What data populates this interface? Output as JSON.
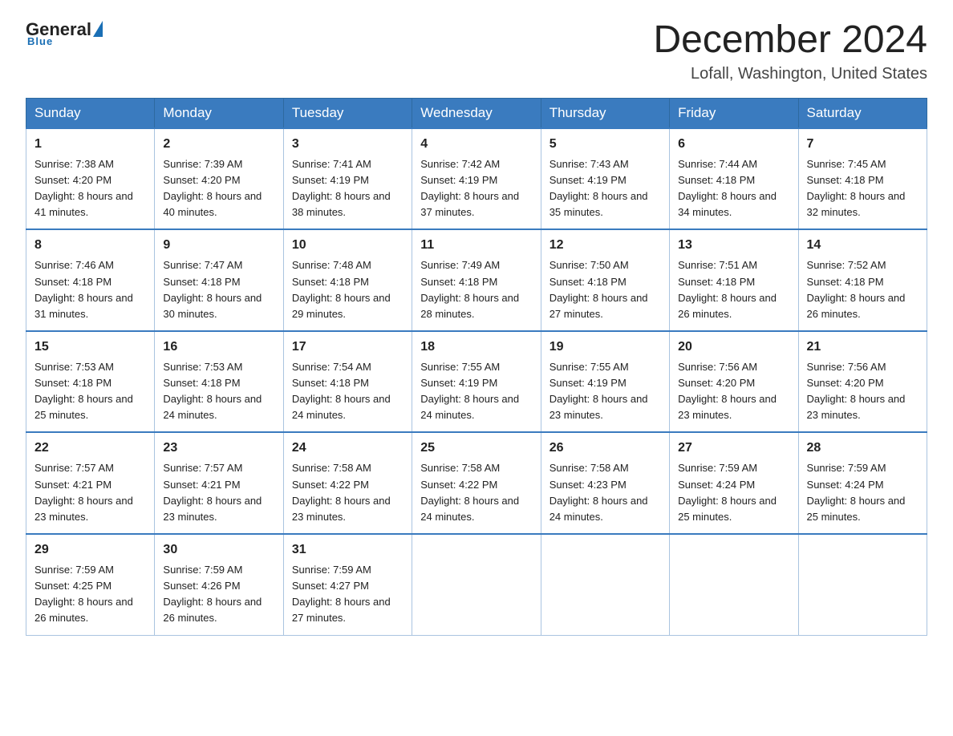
{
  "header": {
    "logo_general": "General",
    "logo_blue": "Blue",
    "main_title": "December 2024",
    "subtitle": "Lofall, Washington, United States"
  },
  "days_of_week": [
    "Sunday",
    "Monday",
    "Tuesday",
    "Wednesday",
    "Thursday",
    "Friday",
    "Saturday"
  ],
  "weeks": [
    [
      {
        "day": "1",
        "sunrise": "7:38 AM",
        "sunset": "4:20 PM",
        "daylight": "8 hours and 41 minutes."
      },
      {
        "day": "2",
        "sunrise": "7:39 AM",
        "sunset": "4:20 PM",
        "daylight": "8 hours and 40 minutes."
      },
      {
        "day": "3",
        "sunrise": "7:41 AM",
        "sunset": "4:19 PM",
        "daylight": "8 hours and 38 minutes."
      },
      {
        "day": "4",
        "sunrise": "7:42 AM",
        "sunset": "4:19 PM",
        "daylight": "8 hours and 37 minutes."
      },
      {
        "day": "5",
        "sunrise": "7:43 AM",
        "sunset": "4:19 PM",
        "daylight": "8 hours and 35 minutes."
      },
      {
        "day": "6",
        "sunrise": "7:44 AM",
        "sunset": "4:18 PM",
        "daylight": "8 hours and 34 minutes."
      },
      {
        "day": "7",
        "sunrise": "7:45 AM",
        "sunset": "4:18 PM",
        "daylight": "8 hours and 32 minutes."
      }
    ],
    [
      {
        "day": "8",
        "sunrise": "7:46 AM",
        "sunset": "4:18 PM",
        "daylight": "8 hours and 31 minutes."
      },
      {
        "day": "9",
        "sunrise": "7:47 AM",
        "sunset": "4:18 PM",
        "daylight": "8 hours and 30 minutes."
      },
      {
        "day": "10",
        "sunrise": "7:48 AM",
        "sunset": "4:18 PM",
        "daylight": "8 hours and 29 minutes."
      },
      {
        "day": "11",
        "sunrise": "7:49 AM",
        "sunset": "4:18 PM",
        "daylight": "8 hours and 28 minutes."
      },
      {
        "day": "12",
        "sunrise": "7:50 AM",
        "sunset": "4:18 PM",
        "daylight": "8 hours and 27 minutes."
      },
      {
        "day": "13",
        "sunrise": "7:51 AM",
        "sunset": "4:18 PM",
        "daylight": "8 hours and 26 minutes."
      },
      {
        "day": "14",
        "sunrise": "7:52 AM",
        "sunset": "4:18 PM",
        "daylight": "8 hours and 26 minutes."
      }
    ],
    [
      {
        "day": "15",
        "sunrise": "7:53 AM",
        "sunset": "4:18 PM",
        "daylight": "8 hours and 25 minutes."
      },
      {
        "day": "16",
        "sunrise": "7:53 AM",
        "sunset": "4:18 PM",
        "daylight": "8 hours and 24 minutes."
      },
      {
        "day": "17",
        "sunrise": "7:54 AM",
        "sunset": "4:18 PM",
        "daylight": "8 hours and 24 minutes."
      },
      {
        "day": "18",
        "sunrise": "7:55 AM",
        "sunset": "4:19 PM",
        "daylight": "8 hours and 24 minutes."
      },
      {
        "day": "19",
        "sunrise": "7:55 AM",
        "sunset": "4:19 PM",
        "daylight": "8 hours and 23 minutes."
      },
      {
        "day": "20",
        "sunrise": "7:56 AM",
        "sunset": "4:20 PM",
        "daylight": "8 hours and 23 minutes."
      },
      {
        "day": "21",
        "sunrise": "7:56 AM",
        "sunset": "4:20 PM",
        "daylight": "8 hours and 23 minutes."
      }
    ],
    [
      {
        "day": "22",
        "sunrise": "7:57 AM",
        "sunset": "4:21 PM",
        "daylight": "8 hours and 23 minutes."
      },
      {
        "day": "23",
        "sunrise": "7:57 AM",
        "sunset": "4:21 PM",
        "daylight": "8 hours and 23 minutes."
      },
      {
        "day": "24",
        "sunrise": "7:58 AM",
        "sunset": "4:22 PM",
        "daylight": "8 hours and 23 minutes."
      },
      {
        "day": "25",
        "sunrise": "7:58 AM",
        "sunset": "4:22 PM",
        "daylight": "8 hours and 24 minutes."
      },
      {
        "day": "26",
        "sunrise": "7:58 AM",
        "sunset": "4:23 PM",
        "daylight": "8 hours and 24 minutes."
      },
      {
        "day": "27",
        "sunrise": "7:59 AM",
        "sunset": "4:24 PM",
        "daylight": "8 hours and 25 minutes."
      },
      {
        "day": "28",
        "sunrise": "7:59 AM",
        "sunset": "4:24 PM",
        "daylight": "8 hours and 25 minutes."
      }
    ],
    [
      {
        "day": "29",
        "sunrise": "7:59 AM",
        "sunset": "4:25 PM",
        "daylight": "8 hours and 26 minutes."
      },
      {
        "day": "30",
        "sunrise": "7:59 AM",
        "sunset": "4:26 PM",
        "daylight": "8 hours and 26 minutes."
      },
      {
        "day": "31",
        "sunrise": "7:59 AM",
        "sunset": "4:27 PM",
        "daylight": "8 hours and 27 minutes."
      },
      null,
      null,
      null,
      null
    ]
  ]
}
